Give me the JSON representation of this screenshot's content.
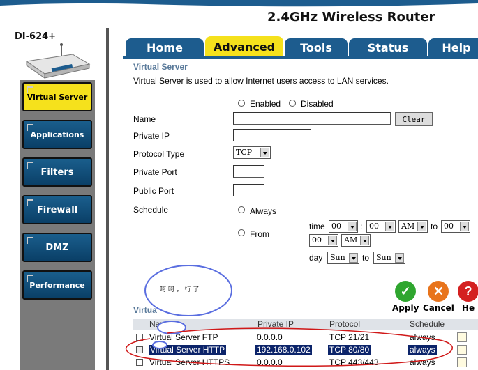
{
  "header": {
    "router_title": "2.4GHz Wireless Router",
    "model": "DI-624+"
  },
  "sidebar": {
    "items": [
      {
        "label": "Virtual Server",
        "active": true
      },
      {
        "label": "Applications"
      },
      {
        "label": "Filters"
      },
      {
        "label": "Firewall"
      },
      {
        "label": "DMZ"
      },
      {
        "label": "Performance"
      }
    ]
  },
  "tabs": [
    {
      "label": "Home"
    },
    {
      "label": "Advanced",
      "active": true
    },
    {
      "label": "Tools"
    },
    {
      "label": "Status"
    },
    {
      "label": "Help"
    }
  ],
  "form": {
    "title": "Virtual Server",
    "description": "Virtual Server is used to allow Internet users access to LAN services.",
    "enabled_label": "Enabled",
    "disabled_label": "Disabled",
    "name_label": "Name",
    "name_value": "",
    "clear_button": "Clear",
    "private_ip_label": "Private IP",
    "private_ip_value": "",
    "protocol_label": "Protocol Type",
    "protocol_value": "TCP",
    "private_port_label": "Private Port",
    "public_port_label": "Public Port",
    "schedule_label": "Schedule",
    "always_label": "Always",
    "from_label": "From",
    "time_label": "time",
    "colon": ":",
    "to_label": "to",
    "day_label": "day",
    "time_start_hour": "00",
    "time_start_min": "00",
    "time_start_ampm": "AM",
    "time_end_hour": "00",
    "time_end_min": "00",
    "time_end_ampm": "AM",
    "day_start": "Sun",
    "day_end": "Sun"
  },
  "actions": {
    "apply": "Apply",
    "cancel": "Cancel",
    "help": "He"
  },
  "list": {
    "title": "Virtua",
    "columns": [
      "Nam",
      "Private IP",
      "Protocol",
      "Schedule"
    ],
    "rows": [
      {
        "name": "Virtual Server FTP",
        "ip": "0.0.0.0",
        "protocol": "TCP 21/21",
        "schedule": "always",
        "checked": false
      },
      {
        "name": "Virtual Server HTTP",
        "ip": "192.168.0.102",
        "protocol": "TCP 80/80",
        "schedule": "always",
        "checked": true,
        "highlighted": true
      },
      {
        "name": "Virtual Server HTTPS",
        "ip": "0.0.0.0",
        "protocol": "TCP 443/443",
        "schedule": "always",
        "checked": false
      }
    ]
  },
  "annotation": {
    "bubble_text": "呵 呵 ， 行 了"
  },
  "colors": {
    "tab_blue": "#1d5c8e",
    "active_yellow": "#f5e11c",
    "highlight_navy": "#0c246a",
    "apply_green": "#2fa62f",
    "cancel_orange": "#e8741c",
    "help_red": "#d42020",
    "annotation_red": "#d01818",
    "bubble_blue": "#5a6ee0"
  }
}
